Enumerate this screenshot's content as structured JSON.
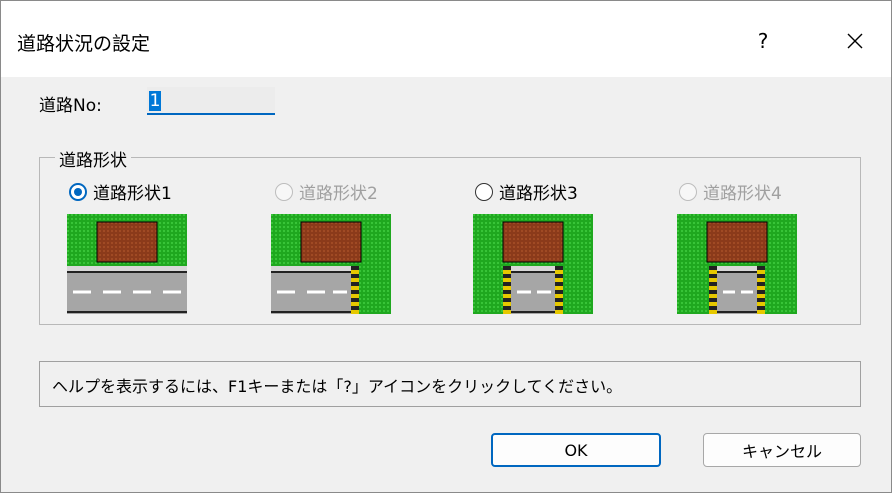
{
  "dialog": {
    "title": "道路状況の設定",
    "help_button": "?",
    "close_icon": "close-icon"
  },
  "road_no": {
    "label": "道路No:",
    "value": "1"
  },
  "road_shape": {
    "group_label": "道路形状",
    "options": [
      {
        "label": "道路形状1",
        "checked": true,
        "enabled": true
      },
      {
        "label": "道路形状2",
        "checked": false,
        "enabled": false
      },
      {
        "label": "道路形状3",
        "checked": false,
        "enabled": true
      },
      {
        "label": "道路形状4",
        "checked": false,
        "enabled": false
      }
    ]
  },
  "status": {
    "text": "ヘルプを表示するには、F1キーまたは「?」アイコンをクリックしてください。"
  },
  "buttons": {
    "ok": "OK",
    "cancel": "キャンセル"
  },
  "colors": {
    "accent": "#0067c0",
    "grass": "#1fa81f",
    "building": "#8b3a1a",
    "road": "#a6a6a6",
    "stripe": "#e6c800"
  }
}
